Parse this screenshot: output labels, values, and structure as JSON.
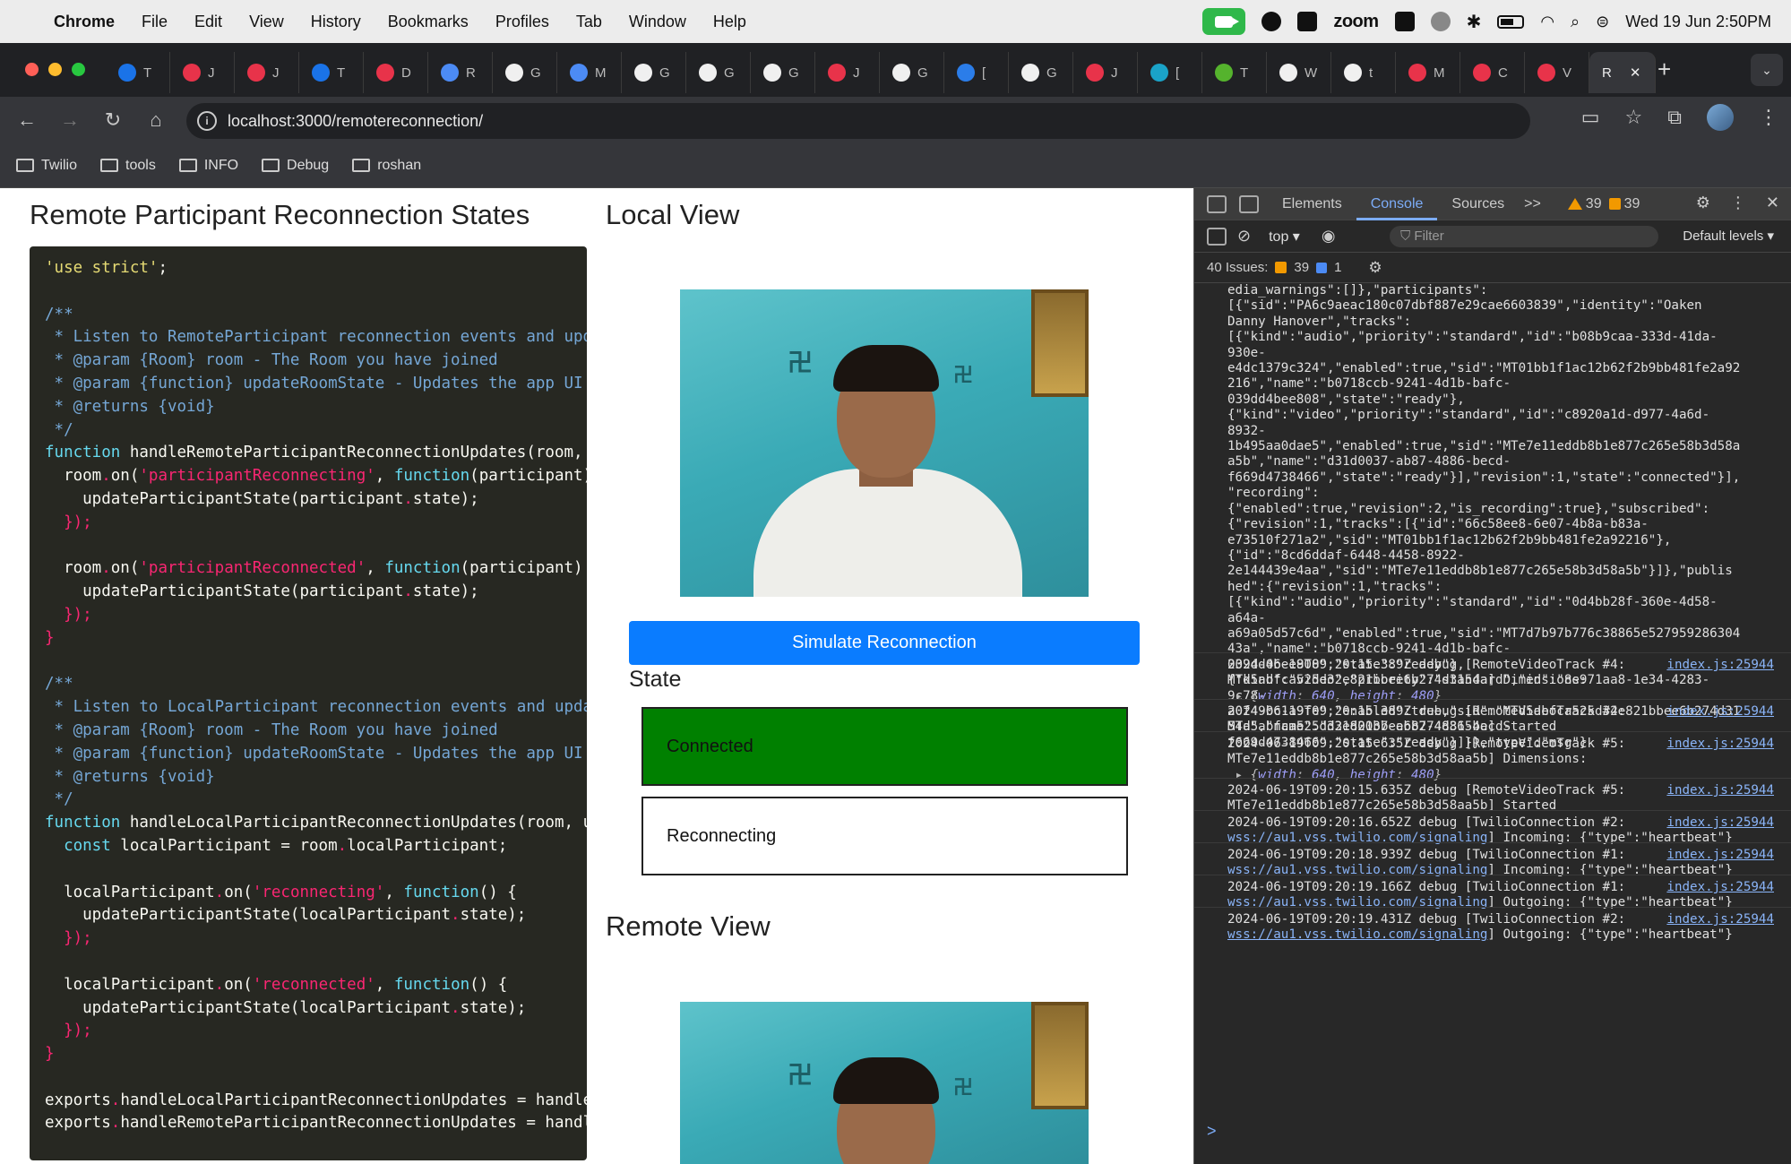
{
  "menubar": {
    "app": "Chrome",
    "items": [
      "File",
      "Edit",
      "View",
      "History",
      "Bookmarks",
      "Profiles",
      "Tab",
      "Window",
      "Help"
    ],
    "zoom_label": "zoom",
    "datetime": "Wed 19 Jun  2:50PM"
  },
  "tabs": [
    {
      "letter": "T",
      "color": "#1a73e8"
    },
    {
      "letter": "J",
      "color": "#e8334a"
    },
    {
      "letter": "J",
      "color": "#e8334a"
    },
    {
      "letter": "T",
      "color": "#1a73e8"
    },
    {
      "letter": "D",
      "color": "#e8334a"
    },
    {
      "letter": "R",
      "color": "#4c8bf5"
    },
    {
      "letter": "G",
      "color": "#f0f0f0"
    },
    {
      "letter": "M",
      "color": "#4c8bf5"
    },
    {
      "letter": "G",
      "color": "#f0f0f0"
    },
    {
      "letter": "G",
      "color": "#f0f0f0"
    },
    {
      "letter": "G",
      "color": "#f0f0f0"
    },
    {
      "letter": "J",
      "color": "#e8334a"
    },
    {
      "letter": "G",
      "color": "#f0f0f0"
    },
    {
      "letter": "[",
      "color": "#2b7de9"
    },
    {
      "letter": "G",
      "color": "#f0f0f0"
    },
    {
      "letter": "J",
      "color": "#e8334a"
    },
    {
      "letter": "[",
      "color": "#1aa3c8"
    },
    {
      "letter": "T",
      "color": "#55b32d"
    },
    {
      "letter": "W",
      "color": "#f0f0f0"
    },
    {
      "letter": "t",
      "color": "#f0f0f0"
    },
    {
      "letter": "M",
      "color": "#e8334a"
    },
    {
      "letter": "C",
      "color": "#e8334a"
    },
    {
      "letter": "V",
      "color": "#e8334a"
    }
  ],
  "active_tab": {
    "letter": "R",
    "close": "✕"
  },
  "toolbar": {
    "url": "localhost:3000/remotereconnection/"
  },
  "bookmarks": [
    "Twilio",
    "tools",
    "INFO",
    "Debug",
    "roshan"
  ],
  "page": {
    "heading_left": "Remote Participant Reconnection States",
    "heading_local": "Local View",
    "heading_remote": "Remote View",
    "simulate_button": "Simulate Reconnection",
    "state_label": "State",
    "state_connected": "Connected",
    "state_reconnecting": "Reconnecting"
  },
  "code_lines": [
    [
      [
        "'use strict'",
        "str"
      ],
      [
        ";",
        "pl"
      ]
    ],
    [],
    [
      [
        "/**",
        "com"
      ]
    ],
    [
      [
        " * Listen to RemoteParticipant reconnection events and upda",
        "com"
      ]
    ],
    [
      [
        " * @param {Room} room - The Room you have joined",
        "com"
      ]
    ],
    [
      [
        " * @param {function} updateRoomState - Updates the app UI w",
        "com"
      ]
    ],
    [
      [
        " * @returns {void}",
        "com"
      ]
    ],
    [
      [
        " */",
        "com"
      ]
    ],
    [
      [
        "function ",
        "kw"
      ],
      [
        "handleRemoteParticipantReconnectionUpdates",
        "pl"
      ],
      [
        "(room, u",
        "pl"
      ]
    ],
    [
      [
        "  room",
        "pl"
      ],
      [
        ".",
        "op"
      ],
      [
        "on(",
        "pl"
      ],
      [
        "'participantReconnecting'",
        "pink"
      ],
      [
        ", ",
        "pl"
      ],
      [
        "function",
        "kw"
      ],
      [
        "(participant) ",
        "pl"
      ]
    ],
    [
      [
        "    updateParticipantState(participant",
        "pl"
      ],
      [
        ".",
        "op"
      ],
      [
        "state);",
        "pl"
      ]
    ],
    [
      [
        "  });",
        "pink"
      ]
    ],
    [],
    [
      [
        "  room",
        "pl"
      ],
      [
        ".",
        "op"
      ],
      [
        "on(",
        "pl"
      ],
      [
        "'participantReconnected'",
        "pink"
      ],
      [
        ", ",
        "pl"
      ],
      [
        "function",
        "kw"
      ],
      [
        "(participant) {",
        "pl"
      ]
    ],
    [
      [
        "    updateParticipantState(participant",
        "pl"
      ],
      [
        ".",
        "op"
      ],
      [
        "state);",
        "pl"
      ]
    ],
    [
      [
        "  });",
        "pink"
      ]
    ],
    [
      [
        "}",
        "pink"
      ]
    ],
    [],
    [
      [
        "/**",
        "com"
      ]
    ],
    [
      [
        " * Listen to LocalParticipant reconnection events and updat",
        "com"
      ]
    ],
    [
      [
        " * @param {Room} room - The Room you have joined",
        "com"
      ]
    ],
    [
      [
        " * @param {function} updateRoomState - Updates the app UI w",
        "com"
      ]
    ],
    [
      [
        " * @returns {void}",
        "com"
      ]
    ],
    [
      [
        " */",
        "com"
      ]
    ],
    [
      [
        "function ",
        "kw"
      ],
      [
        "handleLocalParticipantReconnectionUpdates",
        "pl"
      ],
      [
        "(room, up",
        "pl"
      ]
    ],
    [
      [
        "  ",
        "pl"
      ],
      [
        "const ",
        "kw"
      ],
      [
        "localParticipant = room",
        "pl"
      ],
      [
        ".",
        "op"
      ],
      [
        "localParticipant;",
        "pl"
      ]
    ],
    [],
    [
      [
        "  localParticipant",
        "pl"
      ],
      [
        ".",
        "op"
      ],
      [
        "on(",
        "pl"
      ],
      [
        "'reconnecting'",
        "pink"
      ],
      [
        ", ",
        "pl"
      ],
      [
        "function",
        "kw"
      ],
      [
        "() {",
        "pl"
      ]
    ],
    [
      [
        "    updateParticipantState(localParticipant",
        "pl"
      ],
      [
        ".",
        "op"
      ],
      [
        "state);",
        "pl"
      ]
    ],
    [
      [
        "  });",
        "pink"
      ]
    ],
    [],
    [
      [
        "  localParticipant",
        "pl"
      ],
      [
        ".",
        "op"
      ],
      [
        "on(",
        "pl"
      ],
      [
        "'reconnected'",
        "pink"
      ],
      [
        ", ",
        "pl"
      ],
      [
        "function",
        "kw"
      ],
      [
        "() {",
        "pl"
      ]
    ],
    [
      [
        "    updateParticipantState(localParticipant",
        "pl"
      ],
      [
        ".",
        "op"
      ],
      [
        "state);",
        "pl"
      ]
    ],
    [
      [
        "  });",
        "pink"
      ]
    ],
    [
      [
        "}",
        "pink"
      ]
    ],
    [],
    [
      [
        "exports",
        "pl"
      ],
      [
        ".",
        "op"
      ],
      [
        "handleLocalParticipantReconnectionUpdates = handleL",
        "pl"
      ]
    ],
    [
      [
        "exports",
        "pl"
      ],
      [
        ".",
        "op"
      ],
      [
        "handleRemoteParticipantReconnectionUpdates = handle",
        "pl"
      ]
    ]
  ],
  "devtools": {
    "tabs": [
      "Elements",
      "Console",
      "Sources"
    ],
    "active_tab": "Console",
    "more": ">>",
    "warnings": "39",
    "errors": "39",
    "context": "top",
    "filter_placeholder": "Filter",
    "levels": "Default levels",
    "issues_label": "40 Issues:",
    "issues_warn": "39",
    "issues_info": "1",
    "json_dump": "edia_warnings\":[]},\"participants\":\n[{\"sid\":\"PA6c9aeac180c07dbf887e29cae6603839\",\"identity\":\"Oaken\nDanny Hanover\",\"tracks\":\n[{\"kind\":\"audio\",\"priority\":\"standard\",\"id\":\"b08b9caa-333d-41da-\n930e-\ne4dc1379c324\",\"enabled\":true,\"sid\":\"MT01bb1f1ac12b62f2b9bb481fe2a92\n216\",\"name\":\"b0718ccb-9241-4d1b-bafc-\n039dd4bee808\",\"state\":\"ready\"},\n{\"kind\":\"video\",\"priority\":\"standard\",\"id\":\"c8920a1d-d977-4a6d-\n8932-\n1b495aa0dae5\",\"enabled\":true,\"sid\":\"MTe7e11eddb8b1e877c265e58b3d58a\na5b\",\"name\":\"d31d0037-ab87-4886-becd-\nf669d4738466\",\"state\":\"ready\"}],\"revision\":1,\"state\":\"connected\"}],\n\"recording\":\n{\"enabled\":true,\"revision\":2,\"is_recording\":true},\"subscribed\":\n{\"revision\":1,\"tracks\":[{\"id\":\"66c58ee8-6e07-4b8a-b83a-\ne73510f271a2\",\"sid\":\"MT01bb1f1ac12b62f2b9bb481fe2a92216\"},\n{\"id\":\"8cd6ddaf-6448-4458-8922-\n2e144439e4aa\",\"sid\":\"MTe7e11eddb8b1e877c265e58b3d58a5b\"}]},\"publis\nhed\":{\"revision\":1,\"tracks\":\n[{\"kind\":\"audio\",\"priority\":\"standard\",\"id\":\"0d4bb28f-360e-4d58-\na64a-\na69a05d57c6d\",\"enabled\":true,\"sid\":\"MT7d7b97b776c38865e527959286304\n43a\",\"name\":\"b0718ccb-9241-4d1b-bafc-\n039dd4bee808\",\"state\":\"ready\"},\n{\"kind\":\"video\",\"priority\":\"standard\",\"id\":\"8e971aa8-1e34-4283-\n9c78-\na0f49bc1a9fe\",\"enabled\":true,\"sid\":\"MTd5abfca525d32e821bbee6b274d31\n54a\",\"name\":\"d31d0037-ab87-4886-becd-\nf669d4738466\",\"state\":\"ready\"}]}},\"type\":\"msg\"}",
    "messages": [
      {
        "line1": "2024-06-19T09:20:15.389Z debug [RemoteVideoTrack #4:",
        "line2": "MTd5abfca525d32e821bbee6b274d3154a] Dimensions:",
        "object": {
          "width": "640",
          "height": "480"
        },
        "source": "index.js:25944"
      },
      {
        "line1": "2024-06-19T09:20:15.389Z debug [RemoteVideoTrack #4:",
        "line2": "MTd5abfca525d32e821bbee6b274d3154a] Started",
        "source": "index.js:25944"
      },
      {
        "line1": "2024-06-19T09:20:15.635Z debug [RemoteVideoTrack #5:",
        "line2": "MTe7e11eddb8b1e877c265e58b3d58aa5b] Dimensions:",
        "object": {
          "width": "640",
          "height": "480"
        },
        "source": "index.js:25944"
      },
      {
        "line1": "2024-06-19T09:20:15.635Z debug [RemoteVideoTrack #5:",
        "line2": "MTe7e11eddb8b1e877c265e58b3d58aa5b] Started",
        "source": "index.js:25944"
      },
      {
        "line1": "2024-06-19T09:20:16.652Z debug [TwilioConnection #2:",
        "link2": "wss://au1.vss.twilio.com/signaling",
        "line2": "] Incoming: {\"type\":\"heartbeat\"}",
        "source": "index.js:25944"
      },
      {
        "line1": "2024-06-19T09:20:18.939Z debug [TwilioConnection #1:",
        "link2": "wss://au1.vss.twilio.com/signaling",
        "line2": "] Incoming: {\"type\":\"heartbeat\"}",
        "source": "index.js:25944"
      },
      {
        "line1": "2024-06-19T09:20:19.166Z debug [TwilioConnection #1:",
        "link2": "wss://au1.vss.twilio.com/signaling",
        "line2": "] Outgoing: {\"type\":\"heartbeat\"}",
        "source": "index.js:25944"
      },
      {
        "line1": "2024-06-19T09:20:19.431Z debug [TwilioConnection #2:",
        "link2": "wss://au1.vss.twilio.com/signaling",
        "line2": "] Outgoing: {\"type\":\"heartbeat\"}",
        "source": "index.js:25944"
      }
    ],
    "prompt": ">"
  }
}
